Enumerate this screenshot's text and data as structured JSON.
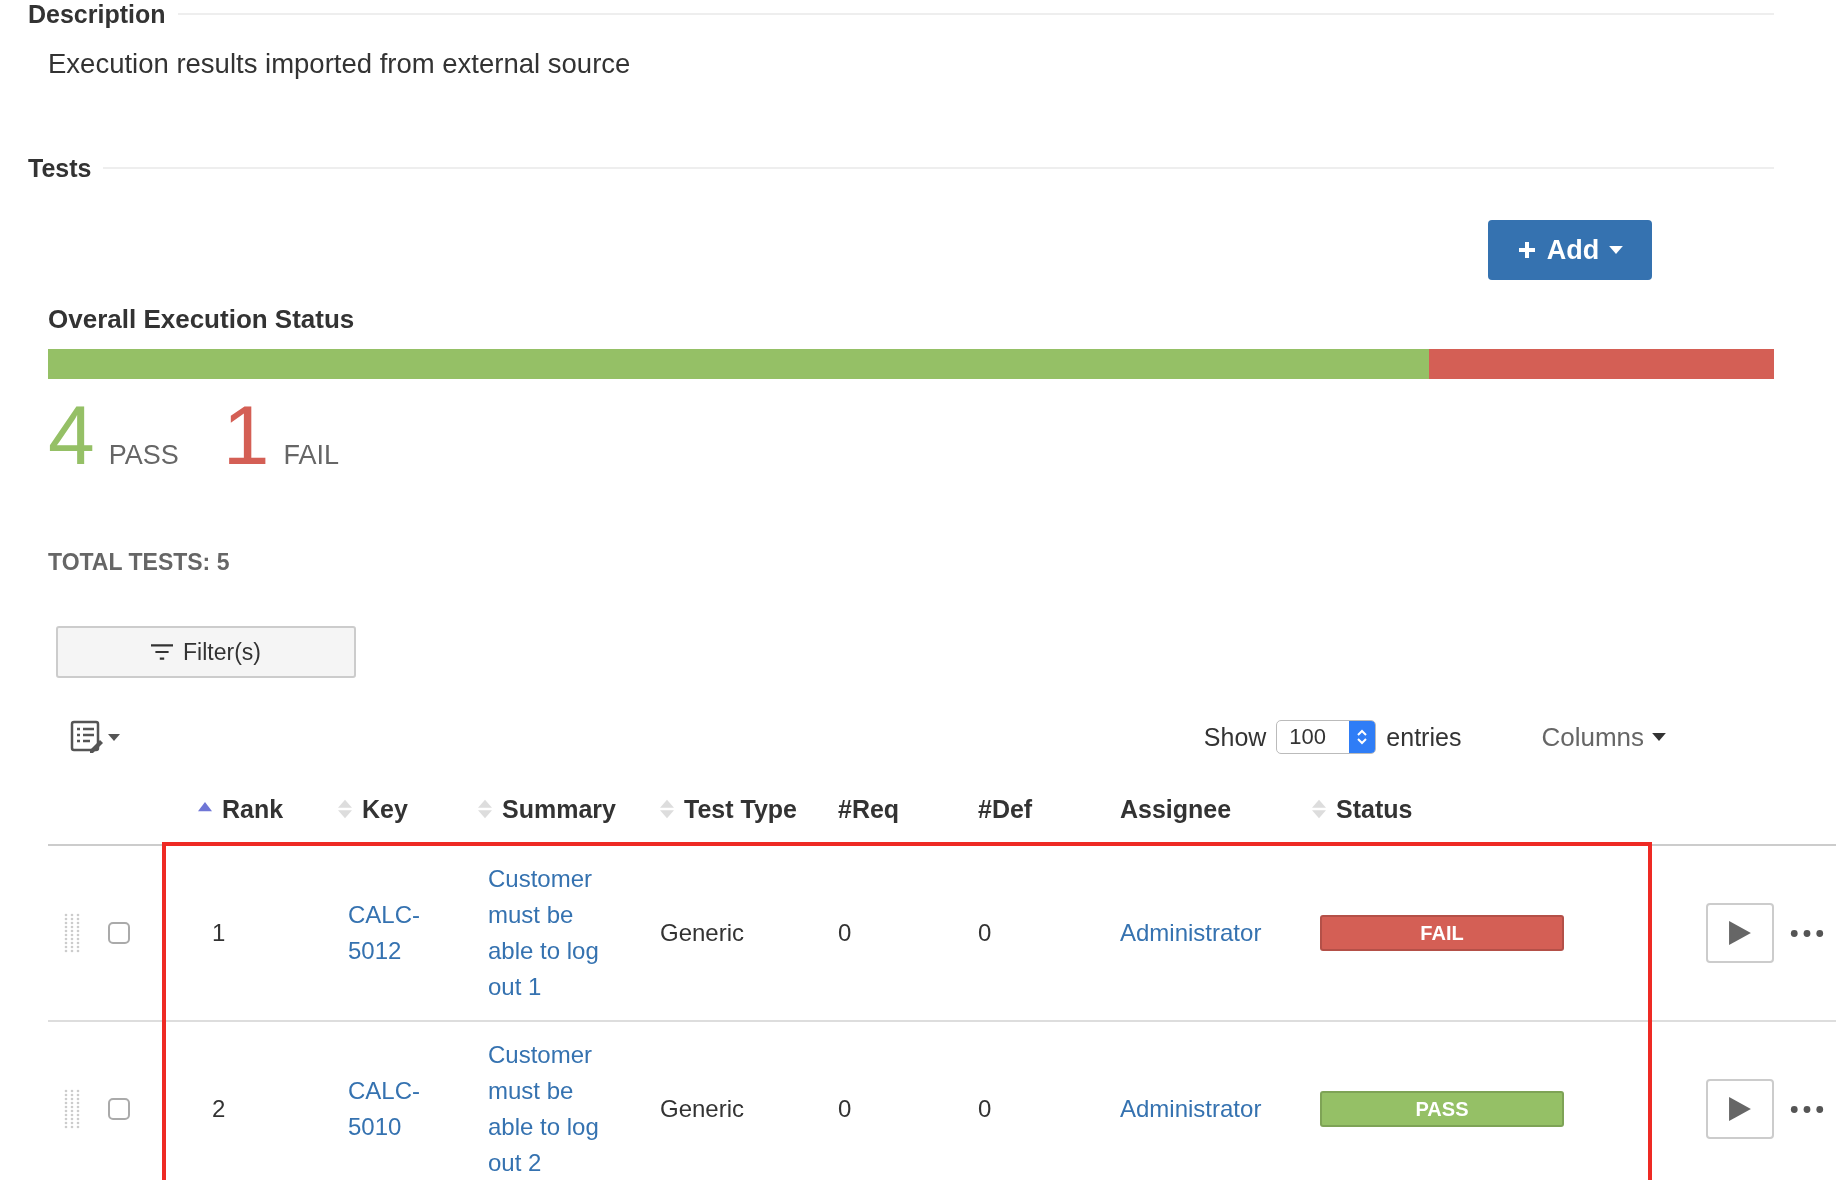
{
  "description": {
    "heading": "Description",
    "text": "Execution results imported from external source"
  },
  "tests": {
    "heading": "Tests",
    "add_button": "Add"
  },
  "overall_status": {
    "title": "Overall Execution Status",
    "pass_bar": {
      "level": 0.8
    },
    "counts": [
      {
        "number": "4",
        "label": "PASS",
        "color": "#95c066"
      },
      {
        "number": "1",
        "label": "FAIL",
        "color": "#d45f55"
      }
    ],
    "total": "TOTAL TESTS: 5"
  },
  "filter_button": "Filter(s)",
  "entries": {
    "show": "Show",
    "value": "100",
    "after": "entries"
  },
  "columns_menu": "Columns",
  "table": {
    "highlighted": true,
    "columns": [
      {
        "label": "Rank",
        "sorted": true
      },
      {
        "label": "Key",
        "sorted": false
      },
      {
        "label": "Summary",
        "sorted": false
      },
      {
        "label": "Test Type",
        "sorted": false
      },
      {
        "label": "#Req"
      },
      {
        "label": "#Def"
      },
      {
        "label": "Assignee"
      },
      {
        "label": "Status",
        "sorted": false
      }
    ],
    "rows": [
      {
        "checked": false,
        "rank": "1",
        "key": "CALC-5012",
        "summary": "Customer must be able to log out 1",
        "test_type": "Generic",
        "req": "0",
        "def": "0",
        "assignee": "Administrator",
        "status": {
          "label": "FAIL",
          "color": "#d45f55"
        }
      },
      {
        "checked": false,
        "rank": "2",
        "key": "CALC-5010",
        "summary": "Customer must be able to log out 2",
        "test_type": "Generic",
        "req": "0",
        "def": "0",
        "assignee": "Administrator",
        "status": {
          "label": "PASS",
          "color": "#95c066"
        }
      }
    ]
  }
}
